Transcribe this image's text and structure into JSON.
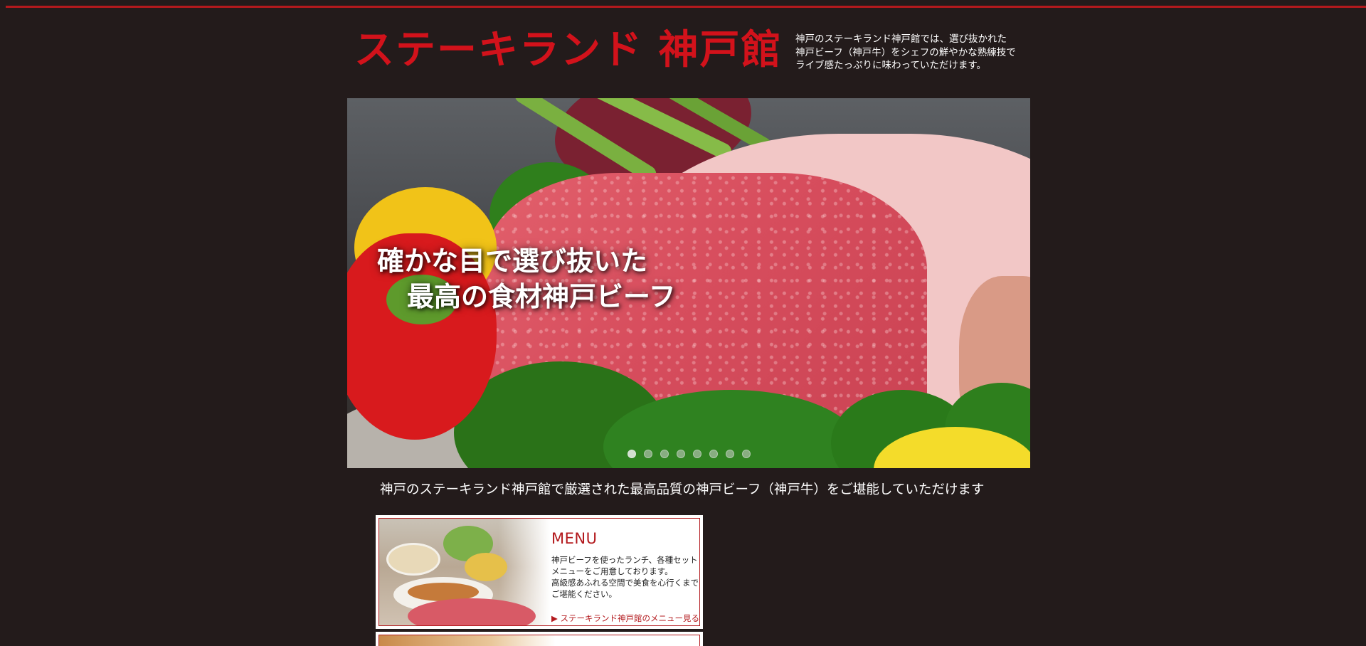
{
  "header": {
    "logo_text": "ステーキランド 神戸館",
    "description_lines": [
      "神戸のステーキランド神戸館では、選び抜かれた",
      "神戸ビーフ（神戸牛）をシェフの鮮やかな熟練技で",
      "ライブ感たっぷりに味わっていただけます。"
    ]
  },
  "hero": {
    "caption_line1": "確かな目で選び抜いた",
    "caption_line2": "最高の食材神戸ビーフ",
    "slide_count": 8,
    "active_slide": 1
  },
  "tagline": "神戸のステーキランド神戸館で厳選された最高品質の神戸ビーフ（神戸牛）をご堪能していただけます",
  "menu_card": {
    "title": "MENU",
    "text_lines": [
      "神戸ビーフを使ったランチ、各種セット",
      "メニューをご用意しております。",
      "高級感あふれる空間で美食を心行くまで",
      "ご堪能ください。"
    ],
    "link_label": "▶ ステーキランド神戸館のメニュー見る"
  },
  "colors": {
    "background": "#231b1b",
    "brand_red": "#b3191d",
    "logo_red": "#d2121b"
  }
}
